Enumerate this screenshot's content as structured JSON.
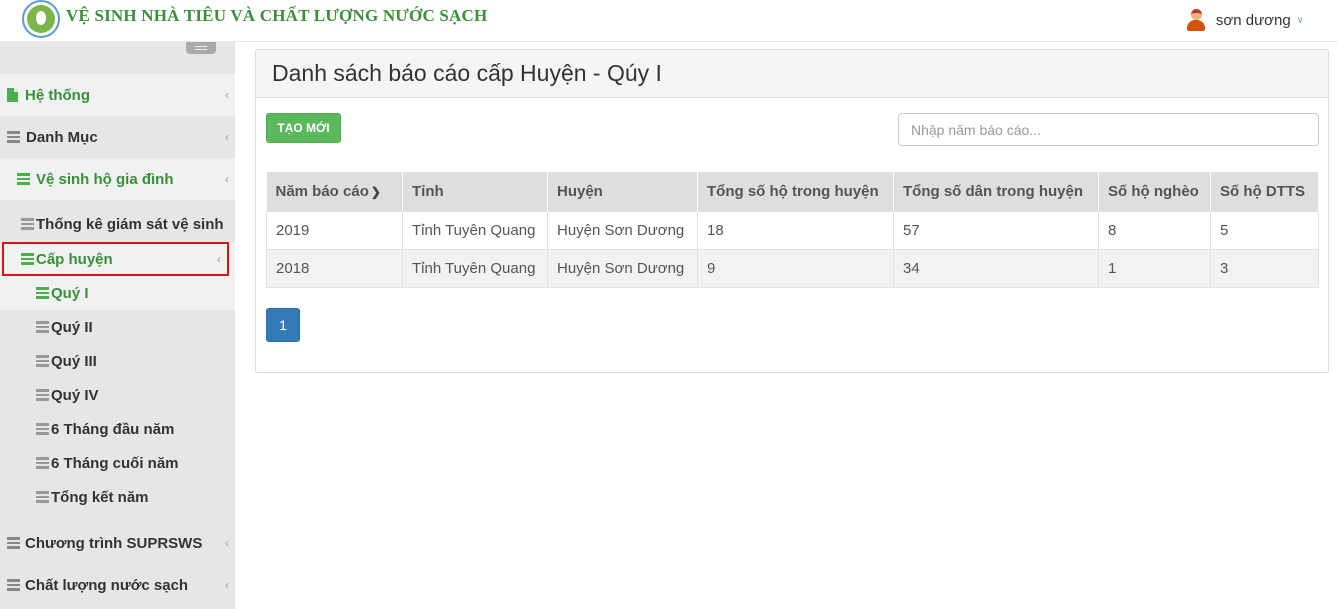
{
  "app": {
    "title": "VỆ SINH NHÀ TIÊU VÀ CHẤT LƯỢNG NƯỚC SẠCH",
    "user_name": "sơn dương"
  },
  "sidebar": {
    "items": [
      {
        "label": "Hệ thống"
      },
      {
        "label": "Danh Mục"
      },
      {
        "label": "Vệ sinh hộ gia đình"
      },
      {
        "label": "Thống kê giám sát vệ sinh"
      },
      {
        "label": "Cấp huyện"
      },
      {
        "label": "Quý I"
      },
      {
        "label": "Quý II"
      },
      {
        "label": "Quý III"
      },
      {
        "label": "Quý IV"
      },
      {
        "label": "6 Tháng đầu năm"
      },
      {
        "label": "6 Tháng cuối năm"
      },
      {
        "label": "Tổng kết năm"
      },
      {
        "label": "Chương trình SUPRSWS"
      },
      {
        "label": "Chất lượng nước sạch"
      }
    ]
  },
  "main": {
    "title": "Danh sách báo cáo cấp Huyện - Qúy I",
    "new_button": "TẠO MỚI",
    "search_placeholder": "Nhập năm báo cáo...",
    "columns": [
      "Năm báo cáo",
      "Tỉnh",
      "Huyện",
      "Tổng số hộ trong huyện",
      "Tổng số dân trong huyện",
      "Số hộ nghèo",
      "Số hộ DTTS"
    ],
    "rows": [
      [
        "2019",
        "Tỉnh Tuyên Quang",
        "Huyện Sơn Dương",
        "18",
        "57",
        "8",
        "5"
      ],
      [
        "2018",
        "Tỉnh Tuyên Quang",
        "Huyện Sơn Dương",
        "9",
        "34",
        "1",
        "3"
      ]
    ],
    "page": "1"
  },
  "colors": {
    "brand_green": "#3a8f3a",
    "button_green": "#5cb85c",
    "page_blue": "#337ab7",
    "highlight_red": "#e01010"
  }
}
